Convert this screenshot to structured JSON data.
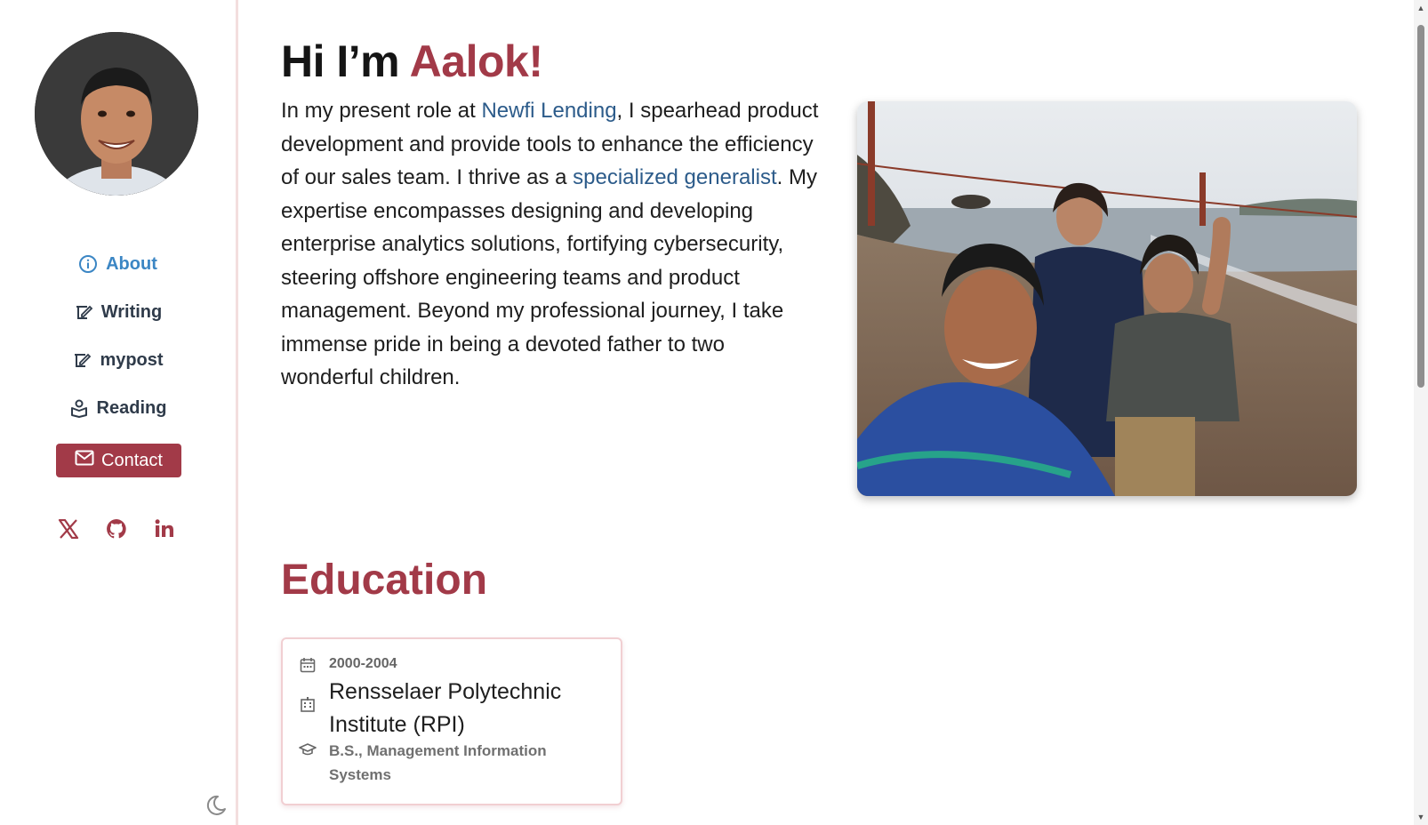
{
  "sidebar": {
    "avatar_alt": "Profile photo",
    "nav": [
      {
        "label": "About",
        "icon": "info-icon",
        "active": true
      },
      {
        "label": "Writing",
        "icon": "write-icon"
      },
      {
        "label": "mypost",
        "icon": "write-icon"
      },
      {
        "label": "Reading",
        "icon": "book-icon"
      }
    ],
    "contact_label": "Contact",
    "socials": [
      {
        "name": "x-icon"
      },
      {
        "name": "github-icon"
      },
      {
        "name": "linkedin-icon"
      }
    ],
    "theme_icon": "moon-icon"
  },
  "hero": {
    "greeting": "Hi I’m ",
    "name": "Aalok!",
    "bio_part1": "In my present role at ",
    "bio_link1": "Newfi Lending",
    "bio_part2": ", I spearhead product development and provide tools to enhance the efficiency of our sales team. I thrive as a ",
    "bio_link2": "specialized generalist",
    "bio_part3": ". My expertise encompasses designing and developing enterprise analytics solutions, fortifying cybersecurity, steering offshore engineering teams and product management. Beyond my professional journey, I take immense pride in being a devoted father to two wonderful children."
  },
  "education": {
    "heading": "Education",
    "entries": [
      {
        "years": "2000-2004",
        "school": "Rensselaer Polytechnic Institute (RPI)",
        "degree": "B.S., Management Information Systems"
      }
    ]
  },
  "colors": {
    "accent": "#a23a48",
    "link": "#2c5b8a",
    "active_nav": "#3b86c4"
  }
}
